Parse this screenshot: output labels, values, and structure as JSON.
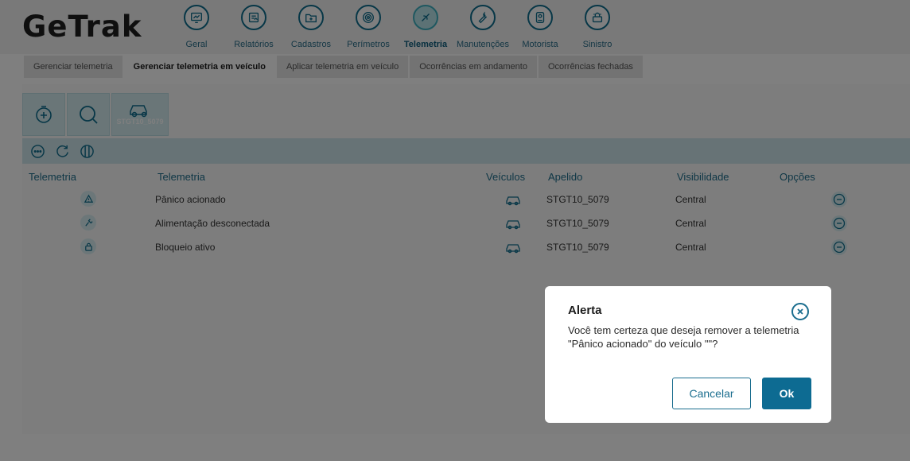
{
  "app": {
    "logo_text": "GeTrak"
  },
  "nav": [
    {
      "label": "Geral",
      "icon": "monitor-chart-icon"
    },
    {
      "label": "Relatórios",
      "icon": "report-icon"
    },
    {
      "label": "Cadastros",
      "icon": "folder-plus-icon"
    },
    {
      "label": "Perímetros",
      "icon": "perimeter-target-icon"
    },
    {
      "label": "Telemetria",
      "icon": "telemetry-icon",
      "active": true
    },
    {
      "label": "Manutenções",
      "icon": "wrench-icon"
    },
    {
      "label": "Motorista",
      "icon": "driver-badge-icon"
    },
    {
      "label": "Sinistro",
      "icon": "incident-icon"
    }
  ],
  "subtabs": [
    {
      "label": "Gerenciar telemetria"
    },
    {
      "label": "Gerenciar telemetria em veículo",
      "active": true
    },
    {
      "label": "Aplicar telemetria em veículo"
    },
    {
      "label": "Ocorrências em andamento"
    },
    {
      "label": "Ocorrências fechadas"
    }
  ],
  "toolbox": {
    "vehicle_caption": "STGT10_5079"
  },
  "table": {
    "headers": [
      "Telemetria",
      "Telemetria",
      "Veículos",
      "Apelido",
      "Visibilidade",
      "Opções"
    ],
    "rows": [
      {
        "icon": "alert-triangle-icon",
        "telemetria": "Pânico acionado",
        "apelido": "STGT10_5079",
        "visibilidade": "Central"
      },
      {
        "icon": "power-plug-icon",
        "telemetria": "Alimentação desconectada",
        "apelido": "STGT10_5079",
        "visibilidade": "Central"
      },
      {
        "icon": "lock-icon",
        "telemetria": "Bloqueio ativo",
        "apelido": "STGT10_5079",
        "visibilidade": "Central"
      }
    ]
  },
  "modal": {
    "title": "Alerta",
    "message": "Você tem certeza que deseja remover a telemetria \"Pânico acionado\" do veículo \"\"?",
    "cancel_label": "Cancelar",
    "ok_label": "Ok"
  },
  "colors": {
    "primary": "#0d6b92",
    "accent_light": "#d4ecf0",
    "overlay": "rgba(0,0,0,0.5)"
  }
}
